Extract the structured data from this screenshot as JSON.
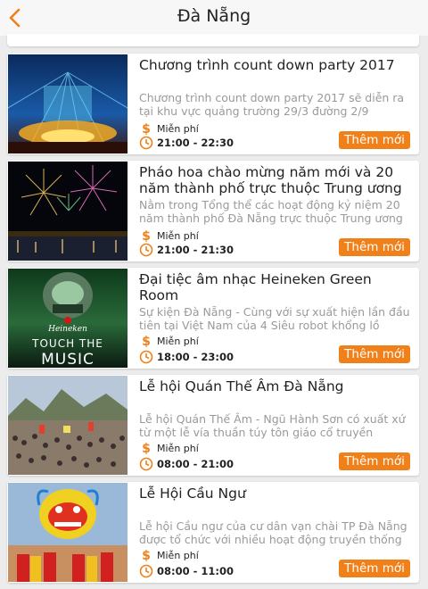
{
  "header": {
    "title": "Đà Nẵng",
    "back_icon": "chevron-left-icon"
  },
  "colors": {
    "accent": "#f0801a",
    "price_icon": "#f0801a"
  },
  "events": [
    {
      "title": "Chương trình count down party 2017",
      "description": "Chương trình count down party 2017 sẽ diễn ra tại khu vực quảng trường 29/3 đường 2/9",
      "price": "Miễn phí",
      "time": "21:00 - 22:30",
      "button": "Thêm mới",
      "image": "countdown-party-stage"
    },
    {
      "title": "Pháo hoa chào mừng năm mới và 20 năm thành phố trực thuộc Trung ương",
      "description": "Nằm trong Tổng thể các hoạt động kỷ niệm 20 năm thành phố Đà Nẵng trực thuộc Trung ương",
      "price": "Miễn phí",
      "time": "21:00 - 21:30",
      "button": "Thêm mới",
      "image": "fireworks"
    },
    {
      "title": "Đại tiệc âm nhạc Heineken Green Room",
      "description": "Sự kiện Đà Nẵng - Cùng với sự xuất hiện lần đầu tiên tại Việt Nam của 4 Siêu robot khổng lồ",
      "price": "Miễn phí",
      "time": "18:00 - 23:00",
      "button": "Thêm mới",
      "image": "heineken-touch-the-music",
      "image_text": {
        "brand": "Heineken",
        "line1": "TOUCH THE",
        "line2": "MUSIC"
      }
    },
    {
      "title": "Lễ hội Quán Thế Âm Đà Nẵng",
      "description": "Lễ hội Quán Thế Âm - Ngũ Hành Sơn có xuất xứ từ một lễ vía thuần túy tôn giáo cổ truyền",
      "price": "Miễn phí",
      "time": "08:00 - 21:00",
      "button": "Thêm mới",
      "image": "festival-crowd"
    },
    {
      "title": "Lễ Hội Cầu Ngư",
      "description": "Lễ hội Cầu ngư của cư dân vạn chài TP Đà Nẵng được tổ chức với nhiều hoạt động truyền thống",
      "price": "Miễn phí",
      "time": "08:00 - 11:00",
      "button": "Thêm mới",
      "image": "dragon-dance"
    }
  ]
}
